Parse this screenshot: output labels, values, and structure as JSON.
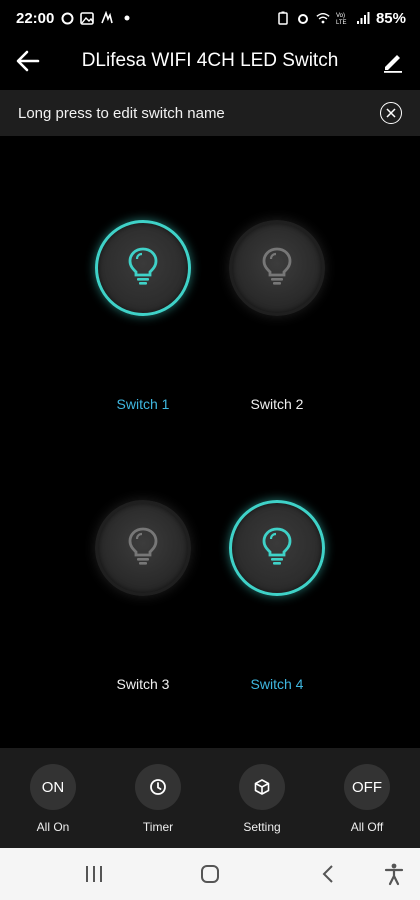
{
  "status": {
    "time": "22:00",
    "battery": "85%"
  },
  "appbar": {
    "title": "DLifesa WIFI 4CH LED Switch"
  },
  "hint": {
    "text": "Long press to edit switch name"
  },
  "switches": [
    {
      "label": "Switch 1",
      "state": "on"
    },
    {
      "label": "Switch 2",
      "state": "off"
    },
    {
      "label": "Switch 3",
      "state": "off"
    },
    {
      "label": "Switch 4",
      "state": "on"
    }
  ],
  "actions": [
    {
      "icon_text": "ON",
      "label": "All On",
      "icon": "on-text-icon"
    },
    {
      "icon_text": "",
      "label": "Timer",
      "icon": "clock-icon"
    },
    {
      "icon_text": "",
      "label": "Setting",
      "icon": "cube-icon"
    },
    {
      "icon_text": "OFF",
      "label": "All Off",
      "icon": "off-text-icon"
    }
  ],
  "colors": {
    "accent": "#3fd2c8",
    "label_on": "#3fb7e0"
  }
}
